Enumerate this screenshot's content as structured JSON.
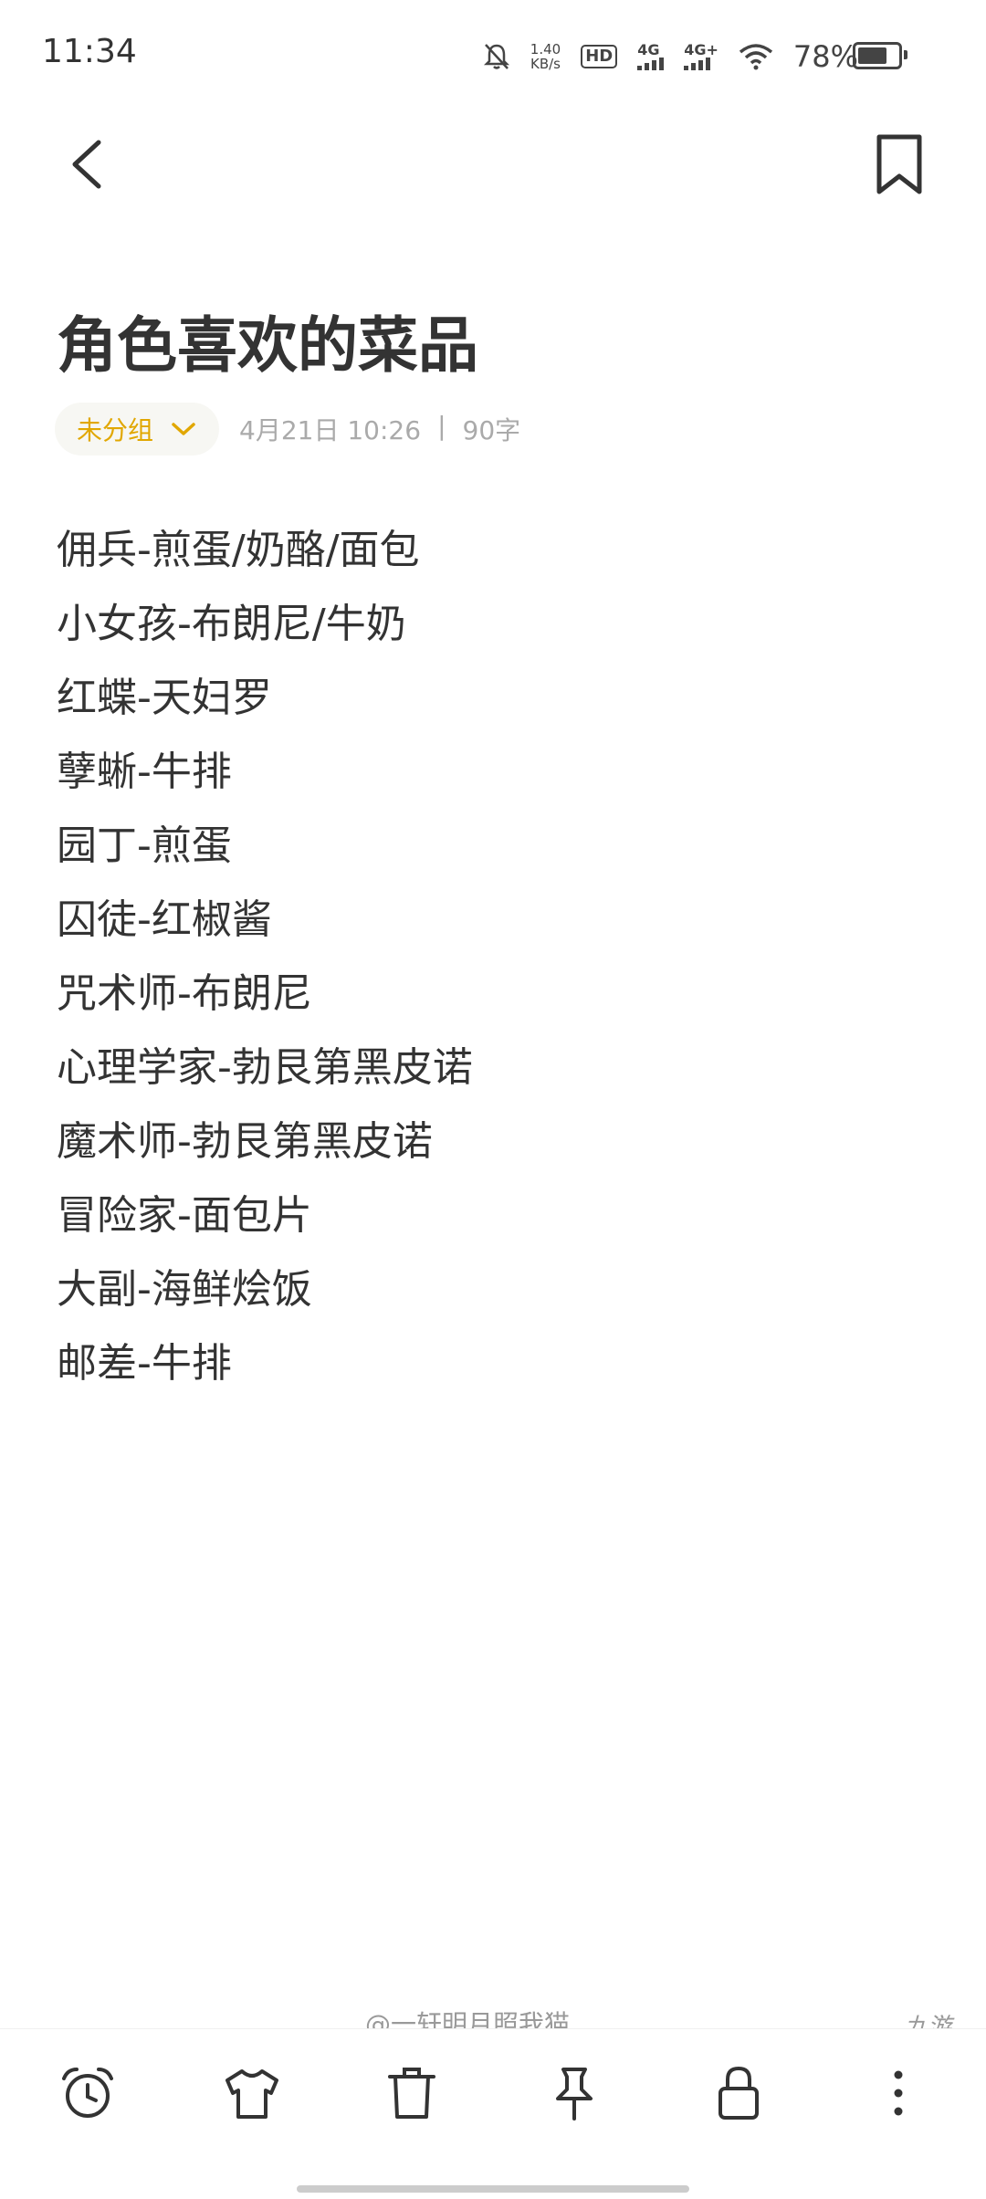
{
  "status_bar": {
    "time": "11:34",
    "speed_value": "1.40",
    "speed_unit": "KB/s",
    "hd_label": "HD",
    "net1": "4G",
    "net2": "4G+",
    "battery_text": "78%",
    "battery_level": 0.78
  },
  "note": {
    "title": "角色喜欢的菜品",
    "group_label": "未分组",
    "date": "4月21日 10:26",
    "separator": "|",
    "word_count": "90字",
    "lines": [
      "佣兵-煎蛋/奶酪/面包",
      "小女孩-布朗尼/牛奶",
      "红蝶-天妇罗",
      "孽蜥-牛排",
      "园丁-煎蛋",
      "囚徒-红椒酱",
      "咒术师-布朗尼",
      "心理学家-勃艮第黑皮诺",
      "魔术师-勃艮第黑皮诺",
      "冒险家-面包片",
      "大副-海鲜烩饭",
      "邮差-牛排"
    ]
  },
  "watermark": {
    "weibo": "@一轩明月照我猫",
    "site": "九游"
  },
  "colors": {
    "accent": "#e1a700",
    "text": "#333333",
    "muted": "#aaaaaa"
  },
  "icons": {
    "back": "chevron-left-icon",
    "bookmark": "bookmark-icon",
    "toolbar": [
      "alarm-clock-icon",
      "shirt-icon",
      "trash-icon",
      "pin-icon",
      "lock-icon",
      "more-vertical-icon"
    ]
  }
}
